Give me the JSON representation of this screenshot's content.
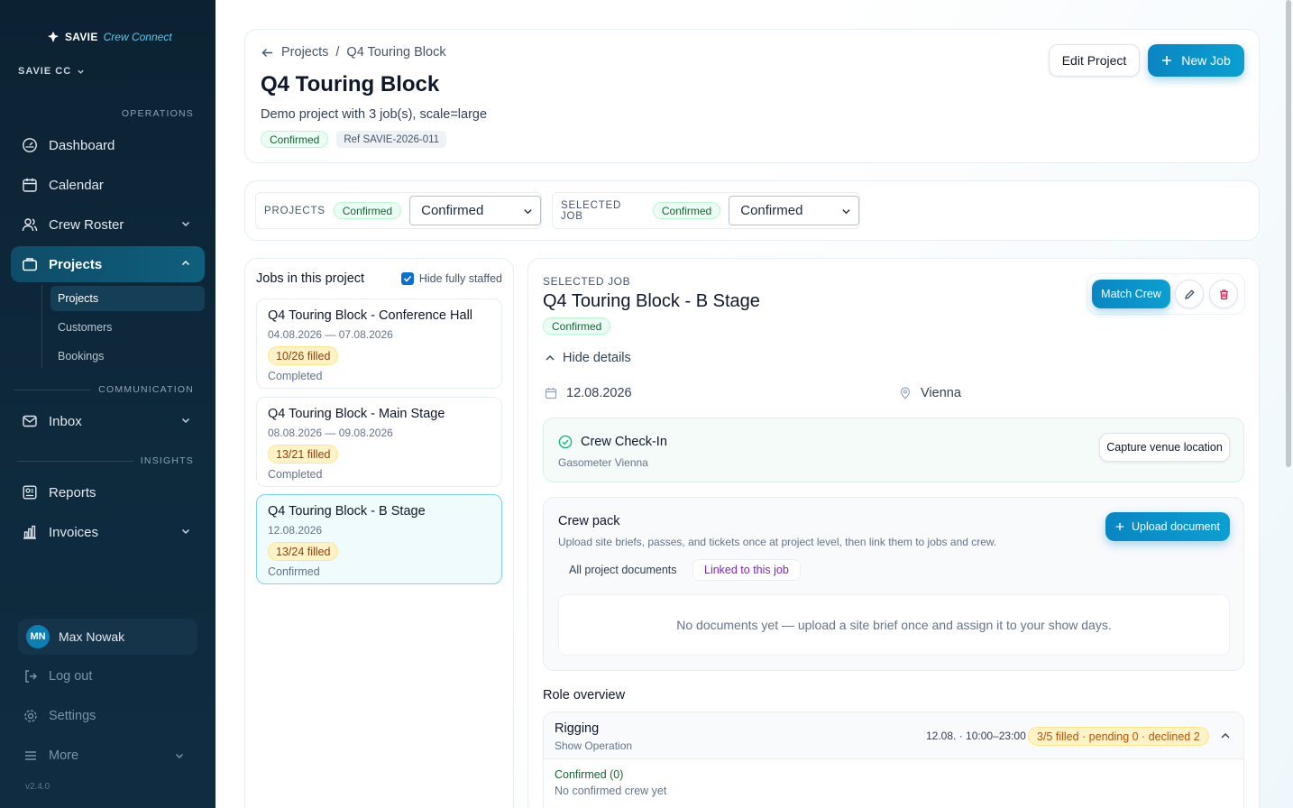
{
  "sidebar": {
    "brand": {
      "name": "SAVIE",
      "product": "Crew Connect"
    },
    "org": "SAVIE CC",
    "sections": {
      "operations": "OPERATIONS",
      "communication": "COMMUNICATION",
      "insights": "INSIGHTS"
    },
    "items": [
      {
        "label": "Dashboard",
        "icon": "dashboard-icon"
      },
      {
        "label": "Calendar",
        "icon": "calendar-icon"
      },
      {
        "label": "Crew Roster",
        "icon": "users-icon"
      },
      {
        "label": "Projects",
        "icon": "briefcase-icon"
      },
      {
        "label": "Inbox",
        "icon": "inbox-icon"
      },
      {
        "label": "Reports",
        "icon": "reports-icon"
      },
      {
        "label": "Invoices",
        "icon": "bar-chart-icon"
      }
    ],
    "sub_items": [
      "Projects",
      "Customers",
      "Bookings"
    ],
    "user": {
      "initials": "MN",
      "name": "Max Nowak"
    },
    "bottom": {
      "logout": "Log out",
      "settings": "Settings",
      "more": "More"
    },
    "version": "v2.4.0"
  },
  "header": {
    "breadcrumb": {
      "parent": "Projects",
      "separator": "/",
      "current": "Q4 Touring Block"
    },
    "title": "Q4 Touring Block",
    "description": "Demo project with 3 job(s), scale=large",
    "status": "Confirmed",
    "ref": "Ref SAVIE-2026-011",
    "edit_label": "Edit Project",
    "new_job_label": "New Job"
  },
  "filters": {
    "projects": {
      "label": "PROJECTS",
      "badge": "Confirmed",
      "value": "Confirmed"
    },
    "selected_job": {
      "label": "SELECTED JOB",
      "badge": "Confirmed",
      "value": "Confirmed"
    }
  },
  "jobs_panel": {
    "title": "Jobs in this project",
    "hide_label": "Hide fully staffed",
    "hide_checked": true,
    "jobs": [
      {
        "title": "Q4 Touring Block - Conference Hall",
        "dates": "04.08.2026 — 07.08.2026",
        "filled": "10/26 filled",
        "status": "Completed"
      },
      {
        "title": "Q4 Touring Block - Main Stage",
        "dates": "08.08.2026 — 09.08.2026",
        "filled": "13/21 filled",
        "status": "Completed"
      },
      {
        "title": "Q4 Touring Block - B Stage",
        "dates": "12.08.2026",
        "filled": "13/24 filled",
        "status": "Confirmed"
      }
    ]
  },
  "job_detail": {
    "eyebrow": "SELECTED JOB",
    "title": "Q4 Touring Block - B Stage",
    "status": "Confirmed",
    "match_label": "Match Crew",
    "hide_details": "Hide details",
    "date": "12.08.2026",
    "location": "Vienna",
    "checkin": {
      "title": "Crew Check-In",
      "venue": "Gasometer Vienna",
      "button": "Capture venue location"
    },
    "crew_pack": {
      "title": "Crew pack",
      "desc": "Upload site briefs, passes, and tickets once at project level, then link them to jobs and crew.",
      "upload_label": "Upload document",
      "tabs": [
        "All project documents",
        "Linked to this job"
      ],
      "empty": "No documents yet — upload a site brief once and assign it to your show days."
    },
    "role_overview": {
      "title": "Role overview",
      "role": {
        "name": "Rigging",
        "dept": "Show Operation",
        "time": "12.08. · 10:00–23:00",
        "summary": "3/5 filled · pending 0 · declined 2",
        "confirmed": "Confirmed (0)",
        "none": "No confirmed crew yet"
      }
    }
  },
  "colors": {
    "accent": "#0b9fd1",
    "sidebar": "#0e2a3d",
    "success": "#166534",
    "warning": "#92400e",
    "danger": "#e11d48"
  }
}
